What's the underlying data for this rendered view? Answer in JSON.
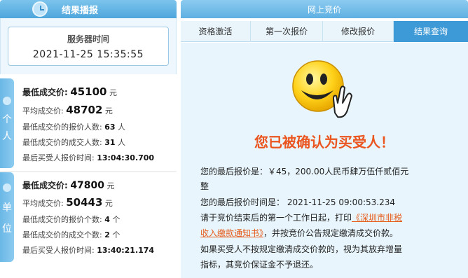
{
  "left": {
    "header_title": "结果播报",
    "server_label": "服务器时间",
    "server_time": "2021-11-25 15:35:55",
    "individual": {
      "tab_label": [
        "个",
        "人"
      ],
      "min_price_label": "最低成交价:",
      "min_price": "45100",
      "avg_price_label": "平均成交价:",
      "avg_price": "48702",
      "min_bidders_label": "最低成交价的报价人数:",
      "min_bidders": "63",
      "deal_count_label": "最低成交价的成交人数:",
      "deal_count": "31",
      "last_time_label": "最后买受人报价时间:",
      "last_time": "13:04:30.700",
      "yuan": "元",
      "people": "人"
    },
    "organization": {
      "tab_label": [
        "单",
        "位"
      ],
      "min_price_label": "最低成交价:",
      "min_price": "47800",
      "avg_price_label": "平均成交价:",
      "avg_price": "50443",
      "min_bidders_label": "最低成交价的报价个数:",
      "min_bidders": "4",
      "deal_count_label": "最低成交价的成交个数:",
      "deal_count": "2",
      "last_time_label": "最后买受人报价时间:",
      "last_time": "13:40:21.174",
      "yuan": "元",
      "unit": "个"
    }
  },
  "right": {
    "header_title": "网上竞价",
    "tabs": [
      "资格激活",
      "第一次报价",
      "修改报价",
      "结果查询"
    ],
    "active_tab": 3,
    "headline": "您已被确认为买受人！",
    "line1": "您的最后报价是：￥45，200.00人民币肆万伍仟贰佰元",
    "line1b": "整",
    "line2": "您的最后报价时间是：  2021-11-25 09:00:53.234",
    "line3_pre": "请于竞价结束后的第一个工作日起，打印",
    "line3_link": "《深圳市非税",
    "line4_link": "收入缴款通知书》",
    "line4_post": "，并按竞价公告规定缴清成交价款。",
    "line5": "如果买受人不按规定缴清成交价款的，视为其放弃增量",
    "line6": "指标，其竞价保证金不予退还。"
  },
  "colors": {
    "accent": "#3e9ad6",
    "headline": "#ea5520",
    "link": "#e65a1a"
  },
  "icons": [
    "clock-icon",
    "person-icon",
    "group-icon",
    "smiley-thumbs-up-icon"
  ]
}
